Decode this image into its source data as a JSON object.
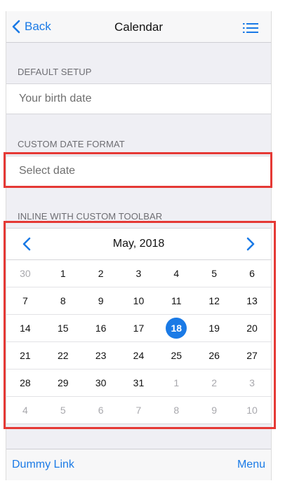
{
  "navbar": {
    "back_label": "Back",
    "title": "Calendar"
  },
  "sections": {
    "default_title": "DEFAULT SETUP",
    "default_placeholder": "Your birth date",
    "custom_title": "CUSTOM DATE FORMAT",
    "custom_placeholder": "Select date",
    "inline_title": "INLINE WITH CUSTOM TOOLBAR"
  },
  "calendar": {
    "month_label": "May, 2018",
    "weeks": [
      [
        {
          "d": "30",
          "o": true
        },
        {
          "d": "1"
        },
        {
          "d": "2"
        },
        {
          "d": "3"
        },
        {
          "d": "4"
        },
        {
          "d": "5"
        },
        {
          "d": "6"
        }
      ],
      [
        {
          "d": "7"
        },
        {
          "d": "8"
        },
        {
          "d": "9"
        },
        {
          "d": "10"
        },
        {
          "d": "11"
        },
        {
          "d": "12"
        },
        {
          "d": "13"
        }
      ],
      [
        {
          "d": "14"
        },
        {
          "d": "15"
        },
        {
          "d": "16"
        },
        {
          "d": "17"
        },
        {
          "d": "18",
          "s": true
        },
        {
          "d": "19"
        },
        {
          "d": "20"
        }
      ],
      [
        {
          "d": "21"
        },
        {
          "d": "22"
        },
        {
          "d": "23"
        },
        {
          "d": "24"
        },
        {
          "d": "25"
        },
        {
          "d": "26"
        },
        {
          "d": "27"
        }
      ],
      [
        {
          "d": "28"
        },
        {
          "d": "29"
        },
        {
          "d": "30"
        },
        {
          "d": "31"
        },
        {
          "d": "1",
          "o": true
        },
        {
          "d": "2",
          "o": true
        },
        {
          "d": "3",
          "o": true
        }
      ],
      [
        {
          "d": "4",
          "o": true
        },
        {
          "d": "5",
          "o": true
        },
        {
          "d": "6",
          "o": true
        },
        {
          "d": "7",
          "o": true
        },
        {
          "d": "8",
          "o": true
        },
        {
          "d": "9",
          "o": true
        },
        {
          "d": "10",
          "o": true
        }
      ]
    ]
  },
  "toolbar": {
    "left_link": "Dummy Link",
    "right_link": "Menu"
  },
  "colors": {
    "accent": "#1a7ae6",
    "highlight": "#e53935"
  },
  "icons": [
    "chevron-left-icon",
    "list-menu-icon",
    "chevron-left-icon",
    "chevron-right-icon"
  ]
}
